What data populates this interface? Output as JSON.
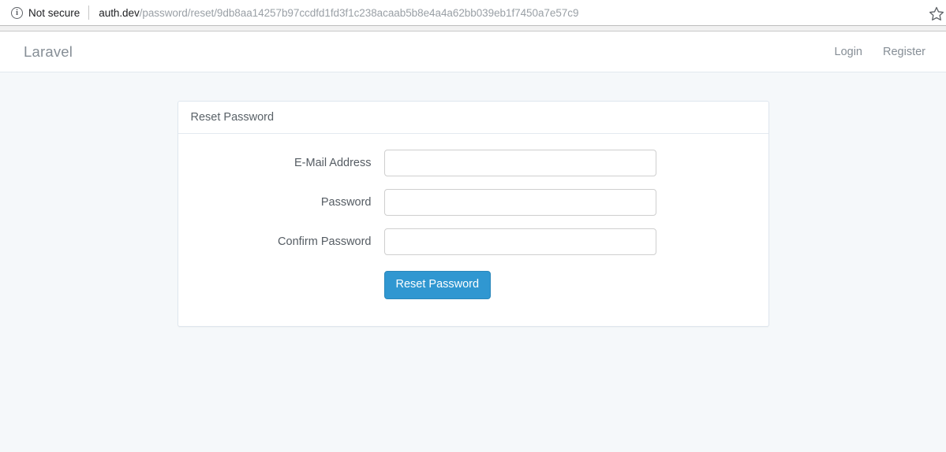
{
  "browser": {
    "security_label": "Not secure",
    "info_icon": "info-circle-icon",
    "url_host": "auth.dev",
    "url_path": "/password/reset/9db8aa14257b97ccdfd1fd3f1c238acaab5b8e4a4a62bb039eb1f7450a7e57c9",
    "bookmark_icon": "star-icon"
  },
  "navbar": {
    "brand": "Laravel",
    "links": [
      {
        "label": "Login"
      },
      {
        "label": "Register"
      }
    ]
  },
  "card": {
    "header_title": "Reset Password",
    "fields": [
      {
        "label": "E-Mail Address",
        "value": "",
        "placeholder": ""
      },
      {
        "label": "Password",
        "value": "",
        "placeholder": ""
      },
      {
        "label": "Confirm Password",
        "value": "",
        "placeholder": ""
      }
    ],
    "submit_label": "Reset Password"
  },
  "colors": {
    "page_background": "#f5f8fa",
    "primary_button": "#3097d1",
    "card_border": "#dfe6ee",
    "text_muted": "#868e96",
    "label_text": "#555c63"
  }
}
